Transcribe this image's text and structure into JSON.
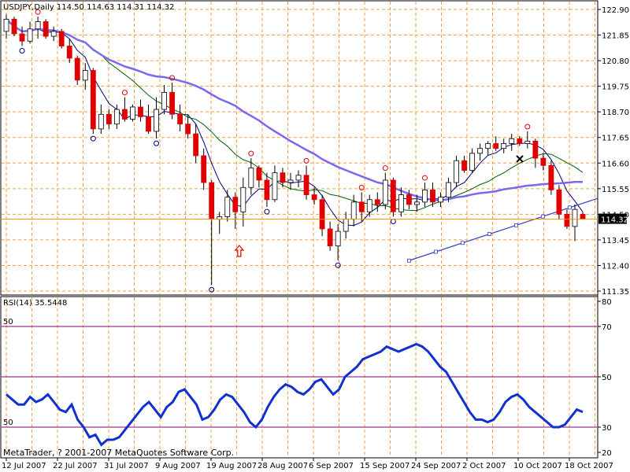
{
  "colors": {
    "background": "#ffffff",
    "grid": "#f0a040",
    "bull": "#ffffff",
    "bear": "#e00000",
    "wick": "#000000",
    "ma_fast": "#000080",
    "ma_mid": "#006400",
    "ma_slow": "#7b68ee",
    "trend": "#3040c0",
    "rsi": "#1030d0",
    "levels": "#800080",
    "fractal_up": "#e00000",
    "fractal_down": "#000080",
    "arrow": "#e00000",
    "price_line": "#ff8c00"
  },
  "chart_data": [
    {
      "type": "candlestick",
      "title": "USDJPY,Daily  114.50 114.63 114.31 114.32",
      "symbol": "USDJPY",
      "timeframe": "Daily",
      "ohlc_header": "114.50 114.63 114.31 114.32",
      "current_price_label": "114.32",
      "ylim": [
        111.35,
        122.9
      ],
      "y_ticks": [
        "122.90",
        "121.85",
        "120.80",
        "119.75",
        "118.70",
        "117.65",
        "116.60",
        "115.55",
        "114.50",
        "113.45",
        "112.40",
        "111.35"
      ],
      "candles": [
        {
          "o": 122.0,
          "h": 122.7,
          "l": 121.7,
          "c": 122.5
        },
        {
          "o": 122.5,
          "h": 122.6,
          "l": 121.8,
          "c": 121.9
        },
        {
          "o": 121.9,
          "h": 122.2,
          "l": 121.4,
          "c": 121.6
        },
        {
          "o": 121.6,
          "h": 122.4,
          "l": 121.5,
          "c": 122.1
        },
        {
          "o": 122.1,
          "h": 122.6,
          "l": 121.7,
          "c": 122.4
        },
        {
          "o": 122.4,
          "h": 122.5,
          "l": 121.7,
          "c": 121.8
        },
        {
          "o": 121.8,
          "h": 122.2,
          "l": 121.6,
          "c": 122.0
        },
        {
          "o": 122.0,
          "h": 122.1,
          "l": 121.3,
          "c": 121.4
        },
        {
          "o": 121.4,
          "h": 121.7,
          "l": 120.7,
          "c": 120.9
        },
        {
          "o": 120.9,
          "h": 121.0,
          "l": 119.8,
          "c": 120.0
        },
        {
          "o": 120.0,
          "h": 120.7,
          "l": 119.6,
          "c": 120.4
        },
        {
          "o": 120.4,
          "h": 120.5,
          "l": 117.8,
          "c": 118.0
        },
        {
          "o": 118.0,
          "h": 119.0,
          "l": 117.8,
          "c": 118.6
        },
        {
          "o": 118.6,
          "h": 118.8,
          "l": 118.0,
          "c": 118.2
        },
        {
          "o": 118.2,
          "h": 119.0,
          "l": 118.0,
          "c": 118.8
        },
        {
          "o": 118.8,
          "h": 119.3,
          "l": 118.3,
          "c": 118.4
        },
        {
          "o": 118.4,
          "h": 119.0,
          "l": 118.3,
          "c": 118.9
        },
        {
          "o": 118.9,
          "h": 119.2,
          "l": 118.3,
          "c": 118.5
        },
        {
          "o": 118.5,
          "h": 119.0,
          "l": 117.8,
          "c": 117.9
        },
        {
          "o": 117.9,
          "h": 119.3,
          "l": 117.6,
          "c": 118.8
        },
        {
          "o": 118.8,
          "h": 119.8,
          "l": 118.6,
          "c": 119.5
        },
        {
          "o": 119.5,
          "h": 119.9,
          "l": 118.4,
          "c": 118.6
        },
        {
          "o": 118.6,
          "h": 119.0,
          "l": 117.9,
          "c": 118.2
        },
        {
          "o": 118.2,
          "h": 118.6,
          "l": 117.6,
          "c": 117.8
        },
        {
          "o": 117.8,
          "h": 118.2,
          "l": 116.6,
          "c": 116.9
        },
        {
          "o": 116.9,
          "h": 117.2,
          "l": 115.5,
          "c": 115.8
        },
        {
          "o": 115.8,
          "h": 115.9,
          "l": 111.6,
          "c": 114.3
        },
        {
          "o": 114.3,
          "h": 114.6,
          "l": 113.7,
          "c": 114.4
        },
        {
          "o": 114.4,
          "h": 115.5,
          "l": 114.2,
          "c": 115.2
        },
        {
          "o": 115.2,
          "h": 115.4,
          "l": 113.9,
          "c": 114.6
        },
        {
          "o": 114.6,
          "h": 116.0,
          "l": 114.0,
          "c": 115.6
        },
        {
          "o": 115.6,
          "h": 116.8,
          "l": 115.3,
          "c": 116.4
        },
        {
          "o": 116.4,
          "h": 116.5,
          "l": 115.6,
          "c": 115.9
        },
        {
          "o": 115.9,
          "h": 116.2,
          "l": 114.8,
          "c": 115.1
        },
        {
          "o": 115.1,
          "h": 116.5,
          "l": 115.0,
          "c": 116.2
        },
        {
          "o": 116.2,
          "h": 116.4,
          "l": 115.6,
          "c": 115.8
        },
        {
          "o": 115.8,
          "h": 116.2,
          "l": 115.5,
          "c": 115.9
        },
        {
          "o": 115.9,
          "h": 116.3,
          "l": 115.6,
          "c": 116.1
        },
        {
          "o": 116.1,
          "h": 116.5,
          "l": 115.1,
          "c": 115.3
        },
        {
          "o": 115.3,
          "h": 115.6,
          "l": 114.9,
          "c": 115.1
        },
        {
          "o": 115.1,
          "h": 115.3,
          "l": 113.6,
          "c": 113.9
        },
        {
          "o": 113.9,
          "h": 114.2,
          "l": 113.0,
          "c": 113.2
        },
        {
          "o": 113.2,
          "h": 114.1,
          "l": 112.6,
          "c": 113.8
        },
        {
          "o": 113.8,
          "h": 114.6,
          "l": 113.5,
          "c": 114.3
        },
        {
          "o": 114.3,
          "h": 115.3,
          "l": 114.0,
          "c": 115.0
        },
        {
          "o": 115.0,
          "h": 115.4,
          "l": 114.2,
          "c": 114.6
        },
        {
          "o": 114.6,
          "h": 115.3,
          "l": 114.4,
          "c": 115.1
        },
        {
          "o": 115.1,
          "h": 115.4,
          "l": 114.6,
          "c": 114.9
        },
        {
          "o": 114.9,
          "h": 116.2,
          "l": 114.7,
          "c": 115.9
        },
        {
          "o": 115.9,
          "h": 116.0,
          "l": 114.4,
          "c": 114.6
        },
        {
          "o": 114.6,
          "h": 115.6,
          "l": 114.4,
          "c": 115.3
        },
        {
          "o": 115.3,
          "h": 115.5,
          "l": 114.7,
          "c": 114.9
        },
        {
          "o": 114.9,
          "h": 115.3,
          "l": 114.6,
          "c": 115.0
        },
        {
          "o": 115.0,
          "h": 115.8,
          "l": 114.8,
          "c": 115.5
        },
        {
          "o": 115.5,
          "h": 115.8,
          "l": 114.8,
          "c": 115.0
        },
        {
          "o": 115.0,
          "h": 115.4,
          "l": 114.8,
          "c": 115.2
        },
        {
          "o": 115.2,
          "h": 116.0,
          "l": 115.0,
          "c": 115.8
        },
        {
          "o": 115.8,
          "h": 116.9,
          "l": 115.6,
          "c": 116.7
        },
        {
          "o": 116.7,
          "h": 116.9,
          "l": 116.2,
          "c": 116.3
        },
        {
          "o": 116.3,
          "h": 117.2,
          "l": 116.2,
          "c": 117.0
        },
        {
          "o": 117.0,
          "h": 117.4,
          "l": 116.7,
          "c": 117.2
        },
        {
          "o": 117.2,
          "h": 117.5,
          "l": 116.9,
          "c": 117.4
        },
        {
          "o": 117.4,
          "h": 117.7,
          "l": 117.1,
          "c": 117.2
        },
        {
          "o": 117.2,
          "h": 117.6,
          "l": 117.0,
          "c": 117.4
        },
        {
          "o": 117.4,
          "h": 117.8,
          "l": 117.1,
          "c": 117.6
        },
        {
          "o": 117.6,
          "h": 117.7,
          "l": 117.3,
          "c": 117.4
        },
        {
          "o": 117.4,
          "h": 117.9,
          "l": 117.2,
          "c": 117.5
        },
        {
          "o": 117.5,
          "h": 117.6,
          "l": 116.4,
          "c": 116.8
        },
        {
          "o": 116.8,
          "h": 117.0,
          "l": 116.3,
          "c": 116.5
        },
        {
          "o": 116.5,
          "h": 116.7,
          "l": 115.3,
          "c": 115.5
        },
        {
          "o": 115.5,
          "h": 115.7,
          "l": 114.3,
          "c": 114.5
        },
        {
          "o": 114.5,
          "h": 114.7,
          "l": 113.9,
          "c": 114.0
        },
        {
          "o": 114.0,
          "h": 114.9,
          "l": 113.4,
          "c": 114.7
        },
        {
          "o": 114.5,
          "h": 114.6,
          "l": 114.3,
          "c": 114.3
        }
      ],
      "trendlines": [
        {
          "x1": 51,
          "y1": 112.6,
          "x2": 95,
          "y2": 117.3
        }
      ],
      "arrow_index": 30,
      "cross_marker_index": 73
    },
    {
      "type": "line",
      "title": "RSI(14) 35.5448",
      "indicator": "RSI(14)",
      "last_value": "35.5448",
      "ylim": [
        20,
        80
      ],
      "y_ticks": [
        "80",
        "70",
        "50",
        "30",
        "20"
      ],
      "levels": [
        70,
        50,
        30
      ],
      "level_side_labels": [
        "50",
        "50"
      ],
      "values": [
        43,
        41,
        39,
        39,
        42,
        40,
        41,
        43,
        40,
        37,
        36,
        39,
        33,
        30,
        26,
        27,
        23,
        25,
        25,
        26,
        29,
        32,
        35,
        38,
        40,
        37,
        34,
        38,
        40,
        44,
        45,
        42,
        39,
        33,
        34,
        37,
        41,
        43,
        42,
        39,
        36,
        32,
        30,
        33,
        38,
        42,
        45,
        47,
        46,
        44,
        43,
        45,
        48,
        49,
        46,
        43,
        45,
        50,
        52,
        54,
        57,
        58,
        59,
        60,
        62,
        61,
        60,
        61,
        62,
        63,
        62,
        60,
        57,
        54,
        52,
        48,
        44,
        40,
        36,
        33,
        33,
        32,
        33,
        36,
        40,
        42,
        43,
        41,
        38,
        36,
        34,
        32,
        30,
        30,
        31,
        34,
        37,
        36
      ]
    }
  ],
  "x_axis": {
    "labels": [
      "12 Jul 2007",
      "22 Jul 2007",
      "31 Jul 2007",
      "9 Aug 2007",
      "19 Aug 2007",
      "28 Aug 2007",
      "6 Sep 2007",
      "15 Sep 2007",
      "24 Sep 2007",
      "2 Oct 2007",
      "10 Oct 2007",
      "18 Oct 2007"
    ]
  },
  "footer": {
    "copyright": "MetaTrader, ? 2001-2007 MetaQuotes Software Corp."
  }
}
